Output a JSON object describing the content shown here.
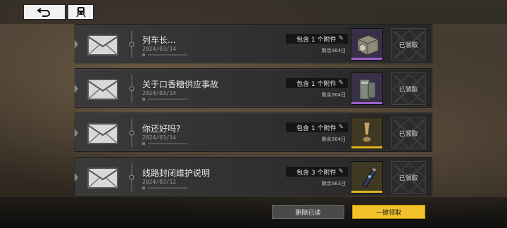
{
  "top_bar": {
    "back_icon": "back-arrow-icon",
    "train_icon": "train-icon"
  },
  "mails": [
    {
      "title": "列车长...",
      "date": "2024/03/14",
      "attachment": "包含 1 个附件",
      "remaining": "剩余364日",
      "status": "已领取",
      "item_icon": "crate-icon",
      "rarity_color": "#9b5fd0",
      "item_bg": "#3a2f48"
    },
    {
      "title": "关于口香糖供应事故",
      "date": "2024/03/14",
      "attachment": "包含 1 个附件",
      "remaining": "剩余364日",
      "status": "已领取",
      "item_icon": "canister-icon",
      "rarity_color": "#9b5fd0",
      "item_bg": "#3a2f48"
    },
    {
      "title": "你还好吗?",
      "date": "2024/03/14",
      "attachment": "包含 1 个附件",
      "remaining": "剩余364日",
      "status": "已领取",
      "item_icon": "cylinder-icon",
      "rarity_color": "#e0b423",
      "item_bg": "#3f3822"
    },
    {
      "title": "线路封闭维护说明",
      "date": "2024/03/12",
      "attachment": "包含 3 个附件",
      "remaining": "剩余363日",
      "status": "已领取",
      "item_icon": "bottle-icon",
      "rarity_color": "#e0b423",
      "item_bg": "#3f3822"
    }
  ],
  "footer": {
    "delete_read_label": "删除已读",
    "claim_all_label": "一键领取"
  },
  "colors": {
    "accent": "#f3c22a",
    "epic": "#9b5fd0",
    "legendary": "#e0b423"
  }
}
